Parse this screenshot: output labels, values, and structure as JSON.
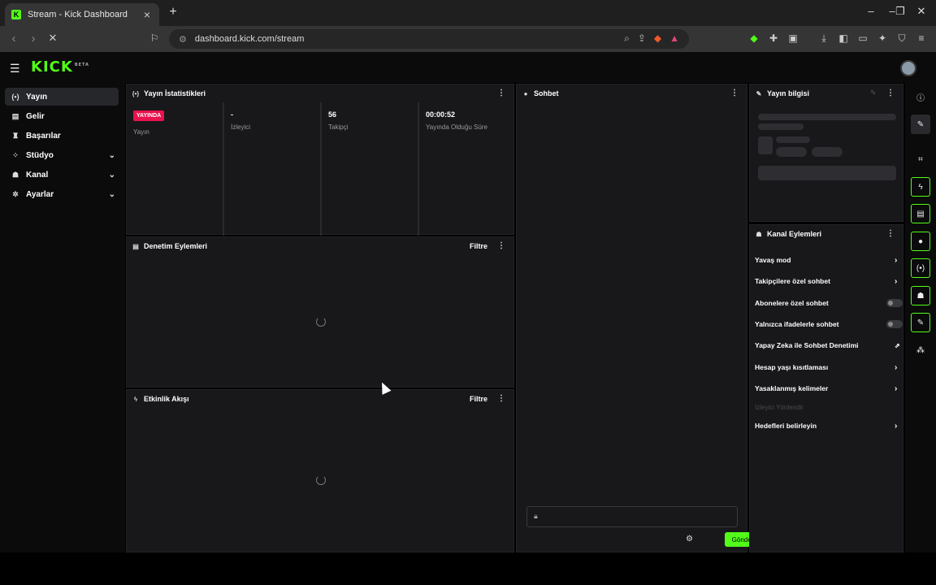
{
  "browser": {
    "tab_title": "Stream - Kick Dashboard",
    "tab_favicon": "kick-favicon",
    "new_tab": "+",
    "url": "dashboard.kick.com/stream",
    "win_minimize": "–",
    "win_restore": "❐",
    "win_close": "✕"
  },
  "header": {
    "logo_text": "KICK",
    "logo_sup": "BETA",
    "menu_icon": "hamburger-icon"
  },
  "sidebar": {
    "items": [
      {
        "label": "Yayın",
        "icon": "broadcast-icon",
        "glyph": "(•)",
        "expandable": false,
        "active": true
      },
      {
        "label": "Gelir",
        "icon": "money-icon",
        "glyph": "▤",
        "expandable": false,
        "active": false
      },
      {
        "label": "Başarılar",
        "icon": "trophy-icon",
        "glyph": "♜",
        "expandable": false,
        "active": false
      },
      {
        "label": "Stüdyo",
        "icon": "studio-icon",
        "glyph": "⁘",
        "expandable": true,
        "active": false
      },
      {
        "label": "Kanal",
        "icon": "channel-icon",
        "glyph": "☗",
        "expandable": true,
        "active": false
      },
      {
        "label": "Ayarlar",
        "icon": "gear-icon",
        "glyph": "✲",
        "expandable": true,
        "active": false
      }
    ]
  },
  "stats_panel": {
    "title": "Yayın İstatistikleri",
    "cells": [
      {
        "value": "YAYINDA",
        "label": "Yayın",
        "is_badge": true
      },
      {
        "value": "-",
        "label": "İzleyici",
        "is_badge": false
      },
      {
        "value": "56",
        "label": "Takipçi",
        "is_badge": false
      },
      {
        "value": "00:00:52",
        "label": "Yayında Olduğu Süre",
        "is_badge": false
      }
    ]
  },
  "moderation_panel": {
    "title": "Denetim Eylemleri",
    "filter_label": "Filtre"
  },
  "activity_panel": {
    "title": "Etkinlik Akışı",
    "filter_label": "Filtre"
  },
  "chat_panel": {
    "title": "Sohbet",
    "input_placeholder": "",
    "send_label": "Gönder"
  },
  "stream_info": {
    "title": "Yayın bilgisi"
  },
  "channel_actions": {
    "title": "Kanal Eylemleri",
    "rows": [
      {
        "label": "Yavaş mod",
        "control": "arrow"
      },
      {
        "label": "Takipçilere özel sohbet",
        "control": "arrow"
      },
      {
        "label": "Abonelere özel sohbet",
        "control": "toggle"
      },
      {
        "label": "Yalnızca ifadelerle sohbet",
        "control": "toggle"
      },
      {
        "label": "Yapay Zeka ile Sohbet Denetimi",
        "control": "external"
      },
      {
        "label": "Hesap yaşı kısıtlaması",
        "control": "arrow"
      },
      {
        "label": "Yasaklanmış kelimeler",
        "control": "arrow"
      }
    ],
    "section_label": "İzleyici Yönlendir",
    "targets_label": "Hedefleri belirleyin"
  },
  "colors": {
    "accent": "#53fc18",
    "live_badge": "#e8124c",
    "panel": "#18181b"
  }
}
